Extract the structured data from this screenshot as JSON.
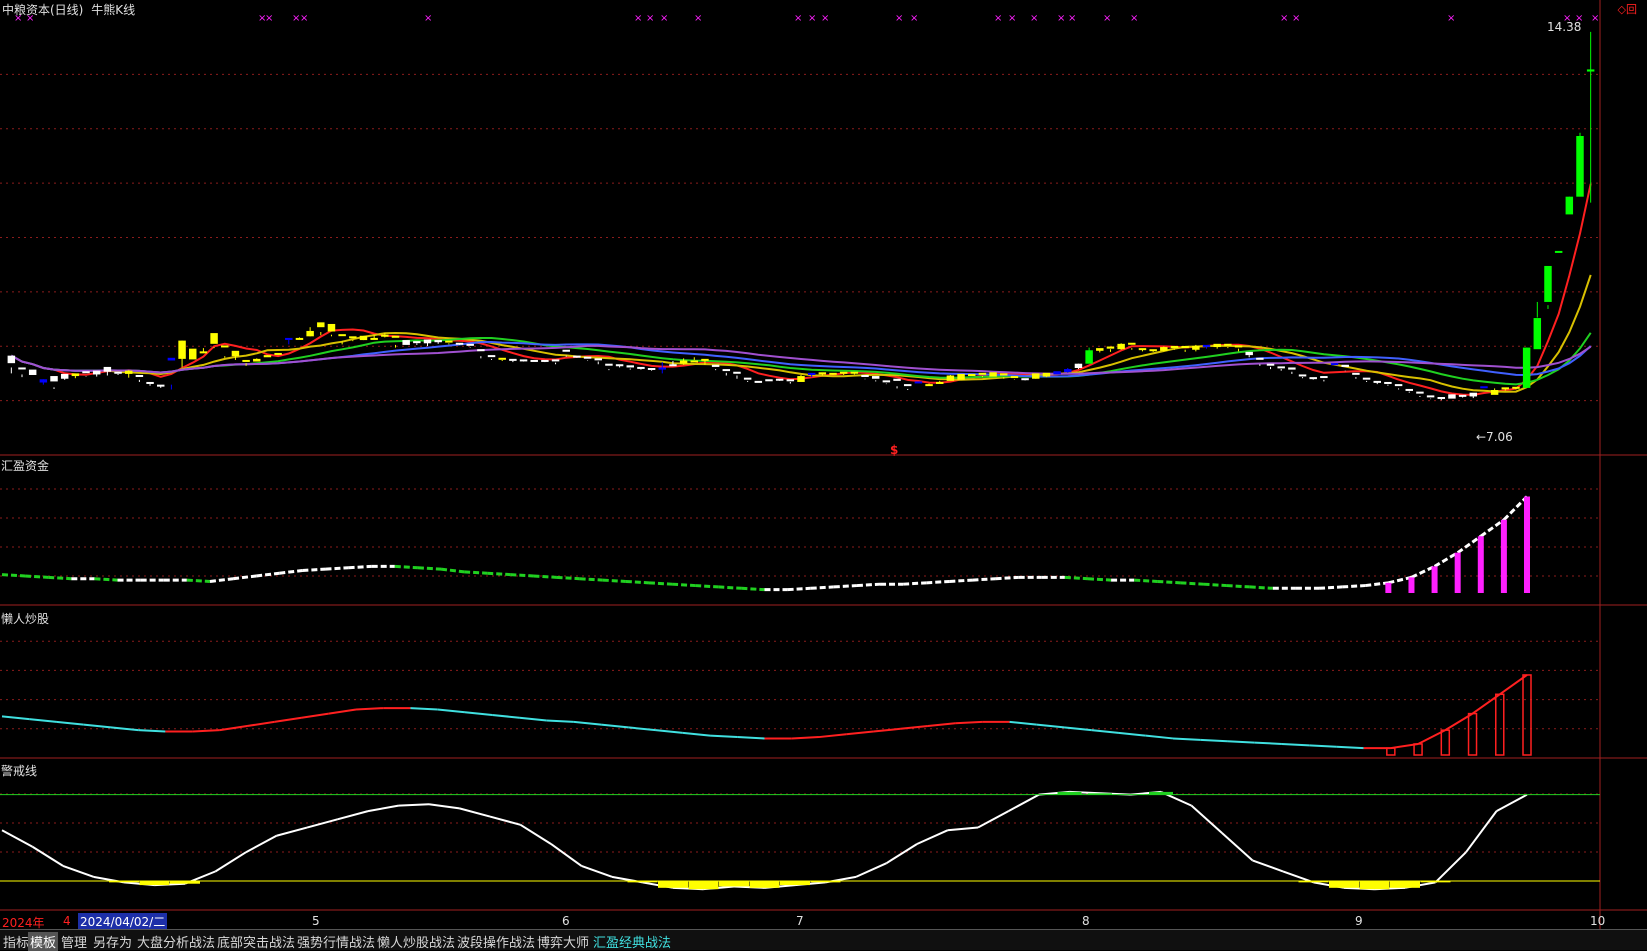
{
  "header": {
    "stock": "中粮资本(日线)",
    "indicator": "牛熊K线"
  },
  "panels": {
    "p2_title": "汇盈资金",
    "p3_title": "懒人炒股",
    "p4_title": "警戒线"
  },
  "main": {
    "price_high_label": "14.38",
    "price_low_label": "←7.06",
    "signal_mark": "$",
    "corner_icons": "◇回"
  },
  "time_axis": {
    "year": "2024年",
    "month_first": "4",
    "date_box": "2024/04/02/二",
    "months": [
      "5",
      "6",
      "7",
      "8",
      "9",
      "10"
    ]
  },
  "toolbar": {
    "tabs": [
      "指标",
      "模板",
      "管理",
      "另存为",
      "大盘分析战法",
      "底部突击战法",
      "强势行情战法",
      "懒人炒股战法",
      "波段操作战法",
      "博弈大师",
      "汇盈经典战法"
    ],
    "active": "模板",
    "highlight": "汇盈经典战法"
  },
  "colors": {
    "background": "#000000",
    "grid": "#8b1c1c",
    "panel_border": "#a02020",
    "up_candle": "#ffff00",
    "down_candle": "#ffffff",
    "blue_candle": "#0000ff",
    "green_candle": "#00ff00",
    "ma_red": "#ff2020",
    "ma_green": "#20d020",
    "ma_blue": "#4060ff",
    "magenta": "#ff20ff",
    "cyan": "#40e0e0",
    "yellow": "#ffff00",
    "white": "#ffffff"
  },
  "chart_data": [
    {
      "type": "candlestick",
      "title": "中粮资本(日线) 牛熊K线",
      "ylim": [
        6.5,
        14.6
      ],
      "annotations": [
        "14.38",
        "←7.06"
      ],
      "ohlc": [
        [
          8.21,
          8.35,
          8.02,
          8.13,
          "w"
        ],
        [
          8.13,
          8.13,
          7.95,
          8.0,
          "w"
        ],
        [
          7.99,
          8.09,
          7.84,
          7.84,
          "w"
        ],
        [
          7.85,
          7.91,
          7.81,
          7.91,
          "b"
        ],
        [
          7.87,
          7.97,
          7.73,
          7.76,
          "w"
        ],
        [
          7.92,
          8.01,
          7.9,
          7.97,
          "w"
        ],
        [
          7.97,
          8.02,
          7.93,
          8.01,
          "y"
        ],
        [
          8.03,
          8.06,
          7.96,
          7.97,
          "w"
        ],
        [
          8.0,
          8.07,
          7.96,
          8.04,
          "w"
        ],
        [
          8.05,
          8.14,
          7.98,
          8.08,
          "w"
        ],
        [
          8.04,
          8.05,
          7.99,
          8.01,
          "w"
        ],
        [
          8.01,
          8.07,
          7.94,
          8.08,
          "y"
        ],
        [
          7.99,
          7.99,
          7.86,
          7.9,
          "w"
        ],
        [
          7.85,
          7.86,
          7.79,
          7.82,
          "w"
        ],
        [
          7.8,
          7.81,
          7.75,
          7.78,
          "w"
        ],
        [
          8.26,
          8.31,
          7.72,
          7.81,
          "b"
        ],
        [
          8.29,
          8.63,
          8.13,
          8.63,
          "y"
        ],
        [
          8.28,
          8.48,
          8.16,
          8.16,
          "y"
        ],
        [
          8.4,
          8.43,
          8.4,
          8.49,
          "y"
        ],
        [
          8.57,
          8.77,
          8.49,
          8.51,
          "y"
        ],
        [
          8.52,
          8.54,
          8.31,
          8.34,
          "y"
        ],
        [
          8.34,
          8.44,
          8.27,
          8.4,
          "y"
        ],
        [
          8.27,
          8.24,
          8.16,
          8.21,
          "y"
        ],
        [
          8.24,
          8.29,
          8.27,
          8.3,
          "y"
        ],
        [
          8.32,
          8.36,
          8.34,
          8.36,
          "y"
        ],
        [
          8.4,
          8.38,
          8.36,
          8.38,
          "y"
        ],
        [
          8.66,
          8.68,
          8.56,
          8.64,
          "b"
        ],
        [
          8.66,
          8.68,
          8.66,
          8.69,
          "y"
        ],
        [
          8.71,
          8.81,
          8.71,
          8.88,
          "y"
        ],
        [
          8.88,
          8.97,
          8.73,
          8.79,
          "y"
        ],
        [
          8.8,
          8.94,
          8.71,
          8.74,
          "y"
        ],
        [
          8.74,
          8.75,
          8.56,
          8.62,
          "y"
        ],
        [
          8.71,
          8.71,
          8.62,
          8.64,
          "y"
        ],
        [
          8.64,
          8.72,
          8.64,
          8.66,
          "y"
        ],
        [
          8.66,
          8.68,
          8.67,
          8.73,
          "y"
        ],
        [
          8.73,
          8.74,
          8.69,
          8.77,
          "y"
        ],
        [
          8.72,
          8.72,
          8.5,
          8.55,
          "y"
        ],
        [
          8.55,
          8.64,
          8.56,
          8.61,
          "w"
        ],
        [
          8.6,
          8.62,
          8.55,
          8.58,
          "w"
        ],
        [
          8.58,
          8.65,
          8.53,
          8.6,
          "w"
        ],
        [
          8.6,
          8.64,
          8.57,
          8.61,
          "w"
        ],
        [
          8.61,
          8.63,
          8.56,
          8.58,
          "y"
        ],
        [
          8.58,
          8.59,
          8.55,
          8.57,
          "w"
        ],
        [
          8.57,
          8.56,
          8.5,
          8.51,
          "w"
        ],
        [
          8.46,
          8.47,
          8.3,
          8.34,
          "w"
        ],
        [
          8.33,
          8.36,
          8.27,
          8.29,
          "w"
        ],
        [
          8.28,
          8.31,
          8.25,
          8.27,
          "y"
        ],
        [
          8.27,
          8.29,
          8.23,
          8.26,
          "w"
        ],
        [
          8.26,
          8.28,
          8.24,
          8.25,
          "w"
        ],
        [
          8.26,
          8.27,
          8.24,
          8.25,
          "w"
        ],
        [
          8.25,
          8.27,
          8.23,
          8.26,
          "w"
        ],
        [
          8.26,
          8.28,
          8.19,
          8.22,
          "w"
        ],
        [
          8.43,
          8.46,
          8.33,
          8.35,
          "w"
        ],
        [
          8.35,
          8.35,
          8.31,
          8.33,
          "w"
        ],
        [
          8.32,
          8.33,
          8.25,
          8.26,
          "w"
        ],
        [
          8.27,
          8.3,
          8.19,
          8.24,
          "w"
        ],
        [
          8.18,
          8.2,
          8.08,
          8.1,
          "w"
        ],
        [
          8.16,
          8.19,
          8.13,
          8.16,
          "w"
        ],
        [
          8.13,
          8.17,
          8.09,
          8.11,
          "w"
        ],
        [
          8.14,
          8.12,
          8.09,
          8.11,
          "w"
        ],
        [
          8.1,
          8.12,
          8.07,
          8.09,
          "w"
        ],
        [
          8.09,
          8.13,
          8.02,
          8.23,
          "b"
        ],
        [
          8.18,
          8.19,
          8.16,
          8.25,
          "w"
        ],
        [
          8.2,
          8.26,
          8.18,
          8.3,
          "y"
        ],
        [
          8.23,
          8.26,
          8.27,
          8.32,
          "y"
        ],
        [
          8.26,
          8.29,
          8.18,
          8.26,
          "y"
        ],
        [
          8.18,
          8.14,
          8.08,
          8.1,
          "w"
        ],
        [
          8.1,
          8.1,
          7.98,
          8.03,
          "w"
        ],
        [
          8.02,
          8.05,
          7.92,
          7.98,
          "w"
        ],
        [
          7.92,
          7.94,
          7.86,
          7.88,
          "w"
        ],
        [
          7.88,
          7.88,
          7.85,
          7.87,
          "w"
        ],
        [
          7.9,
          7.91,
          7.89,
          7.9,
          "w"
        ],
        [
          7.91,
          7.92,
          7.88,
          7.91,
          "w"
        ],
        [
          7.9,
          7.91,
          7.83,
          7.86,
          "w"
        ],
        [
          7.86,
          7.97,
          7.96,
          7.99,
          "y"
        ],
        [
          7.99,
          8.03,
          7.95,
          7.99,
          "b"
        ],
        [
          8.0,
          8.04,
          7.98,
          8.01,
          "y"
        ],
        [
          8.01,
          8.03,
          7.99,
          8.02,
          "y"
        ],
        [
          8.02,
          8.05,
          7.99,
          8.03,
          "y"
        ],
        [
          8.03,
          8.05,
          8.0,
          8.02,
          "y"
        ],
        [
          7.99,
          7.97,
          7.91,
          7.92,
          "w"
        ],
        [
          7.92,
          7.97,
          7.87,
          7.89,
          "w"
        ],
        [
          7.89,
          7.87,
          7.82,
          7.83,
          "w"
        ],
        [
          7.92,
          7.88,
          7.74,
          7.78,
          "w"
        ],
        [
          7.82,
          7.8,
          7.71,
          7.73,
          "w"
        ],
        [
          7.86,
          7.87,
          7.8,
          7.8,
          "b"
        ],
        [
          7.8,
          7.82,
          7.79,
          7.83,
          "y"
        ],
        [
          7.84,
          7.86,
          7.83,
          7.88,
          "y"
        ],
        [
          7.88,
          7.98,
          7.91,
          7.99,
          "y"
        ],
        [
          7.9,
          8.01,
          7.95,
          7.98,
          "y"
        ],
        [
          7.97,
          8.01,
          7.99,
          8.0,
          "y"
        ],
        [
          8.0,
          8.03,
          7.95,
          7.97,
          "y"
        ],
        [
          7.96,
          8.04,
          7.97,
          8.02,
          "y"
        ],
        [
          7.98,
          8.02,
          7.92,
          7.95,
          "y"
        ],
        [
          7.95,
          7.97,
          7.9,
          7.91,
          "y"
        ],
        [
          7.91,
          7.93,
          7.89,
          7.92,
          "w"
        ],
        [
          7.92,
          8.02,
          7.92,
          7.97,
          "y"
        ],
        [
          7.96,
          8.03,
          7.95,
          7.98,
          "y"
        ],
        [
          8.0,
          8.06,
          8.02,
          8.02,
          "b"
        ],
        [
          8.04,
          8.1,
          8.03,
          8.12,
          "b"
        ],
        [
          8.12,
          8.2,
          8.1,
          8.2,
          "w"
        ],
        [
          8.2,
          8.45,
          8.29,
          8.5,
          "g"
        ],
        [
          8.44,
          8.49,
          8.41,
          8.48,
          "y"
        ],
        [
          8.48,
          8.52,
          8.42,
          8.47,
          "y"
        ],
        [
          8.47,
          8.57,
          8.46,
          8.58,
          "y"
        ],
        [
          8.58,
          8.59,
          8.46,
          8.49,
          "y"
        ],
        [
          8.49,
          8.47,
          8.43,
          8.46,
          "y"
        ],
        [
          8.46,
          8.47,
          8.42,
          8.44,
          "y"
        ],
        [
          8.44,
          8.51,
          8.43,
          8.52,
          "y"
        ],
        [
          8.52,
          8.53,
          8.46,
          8.48,
          "y"
        ],
        [
          8.49,
          8.53,
          8.42,
          8.46,
          "y"
        ],
        [
          8.46,
          8.53,
          8.43,
          8.55,
          "y"
        ],
        [
          8.53,
          8.55,
          8.48,
          8.51,
          "b"
        ],
        [
          8.51,
          8.57,
          8.48,
          8.56,
          "y"
        ],
        [
          8.56,
          8.57,
          8.49,
          8.51,
          "y"
        ],
        [
          8.51,
          8.54,
          8.43,
          8.48,
          "y"
        ],
        [
          8.36,
          8.42,
          8.32,
          8.36,
          "w"
        ],
        [
          8.29,
          8.31,
          8.16,
          8.19,
          "w"
        ],
        [
          8.19,
          8.2,
          8.1,
          8.14,
          "w"
        ],
        [
          8.15,
          8.15,
          8.07,
          8.1,
          "w"
        ],
        [
          8.09,
          8.13,
          8.01,
          8.05,
          "w"
        ],
        [
          7.99,
          8.0,
          7.93,
          7.95,
          "w"
        ],
        [
          7.95,
          7.93,
          7.9,
          7.91,
          "w"
        ],
        [
          7.97,
          7.94,
          7.87,
          7.9,
          "w"
        ],
        [
          8.21,
          8.21,
          8.0,
          8.0,
          "b"
        ],
        [
          8.14,
          8.18,
          8.06,
          8.07,
          "w"
        ],
        [
          8.01,
          8.03,
          7.92,
          7.95,
          "w"
        ],
        [
          7.94,
          7.93,
          7.86,
          7.88,
          "w"
        ],
        [
          7.86,
          7.88,
          7.82,
          7.86,
          "w"
        ],
        [
          7.86,
          7.86,
          7.79,
          7.81,
          "w"
        ],
        [
          7.81,
          7.82,
          7.72,
          7.74,
          "w"
        ],
        [
          7.71,
          7.73,
          7.66,
          7.68,
          "w"
        ],
        [
          7.68,
          7.68,
          7.58,
          7.6,
          "w"
        ],
        [
          7.6,
          7.61,
          7.54,
          7.55,
          "w"
        ],
        [
          7.57,
          7.58,
          7.52,
          7.55,
          "w"
        ],
        [
          7.55,
          7.63,
          7.58,
          7.6,
          "w"
        ],
        [
          7.6,
          7.62,
          7.57,
          7.59,
          "w"
        ],
        [
          7.59,
          7.66,
          7.56,
          7.62,
          "w"
        ],
        [
          7.76,
          7.78,
          7.6,
          7.6,
          "b"
        ],
        [
          7.62,
          7.71,
          7.66,
          7.74,
          "y"
        ],
        [
          7.73,
          7.76,
          7.7,
          7.75,
          "y"
        ],
        [
          7.75,
          7.77,
          7.72,
          7.76,
          "y"
        ],
        [
          7.75,
          8.5,
          7.87,
          8.5,
          "g"
        ],
        [
          8.47,
          9.05,
          9.06,
          9.35,
          "g"
        ],
        [
          9.35,
          10.02,
          9.22,
          9.29,
          "g"
        ],
        [
          10.29,
          10.3,
          10.27,
          10.28,
          "g"
        ],
        [
          10.98,
          11.31,
          11.12,
          11.31,
          "g"
        ],
        [
          11.31,
          12.44,
          12.41,
          12.5,
          "g"
        ],
        [
          13.64,
          13.68,
          11.2,
          14.38,
          "g"
        ]
      ],
      "moving_averages": [
        "red",
        "green",
        "yellow",
        "blue",
        "purple"
      ]
    },
    {
      "type": "line",
      "title": "汇盈资金",
      "ylim": [
        0,
        100
      ],
      "values": [
        20,
        19,
        18,
        17,
        17,
        16,
        16,
        16,
        16,
        15,
        17,
        19,
        21,
        23,
        24,
        25,
        26,
        26,
        25,
        24,
        22,
        21,
        20,
        19,
        18,
        17,
        16,
        15,
        14,
        13,
        12,
        11,
        10,
        9,
        9,
        10,
        11,
        12,
        13,
        13,
        14,
        15,
        16,
        17,
        18,
        18,
        18,
        17,
        16,
        16,
        15,
        14,
        13,
        12,
        11,
        10,
        10,
        10,
        11,
        12,
        14,
        18,
        26,
        36,
        48,
        60,
        77
      ]
    },
    {
      "type": "line",
      "title": "懒人炒股",
      "ylim": [
        0,
        100
      ],
      "values": [
        28,
        26,
        24,
        22,
        20,
        18,
        17,
        17,
        18,
        21,
        24,
        27,
        30,
        33,
        34,
        34,
        33,
        31,
        29,
        27,
        25,
        24,
        22,
        20,
        18,
        16,
        14,
        13,
        12,
        12,
        13,
        15,
        17,
        19,
        21,
        23,
        24,
        24,
        22,
        20,
        18,
        16,
        14,
        12,
        11,
        10,
        9,
        8,
        7,
        6,
        5,
        5,
        8,
        18,
        30,
        44,
        58
      ]
    },
    {
      "type": "line",
      "title": "警戒线",
      "ylim": [
        0,
        100
      ],
      "reference_lines": [
        82,
        19
      ],
      "values": [
        56,
        44,
        30,
        22,
        18,
        16,
        17,
        26,
        40,
        52,
        58,
        64,
        70,
        74,
        75,
        72,
        66,
        60,
        46,
        30,
        22,
        18,
        14,
        13,
        15,
        14,
        16,
        18,
        22,
        32,
        46,
        56,
        58,
        70,
        82,
        84,
        83,
        82,
        84,
        74,
        54,
        34,
        26,
        18,
        14,
        13,
        14,
        18,
        40,
        70,
        82
      ]
    }
  ]
}
